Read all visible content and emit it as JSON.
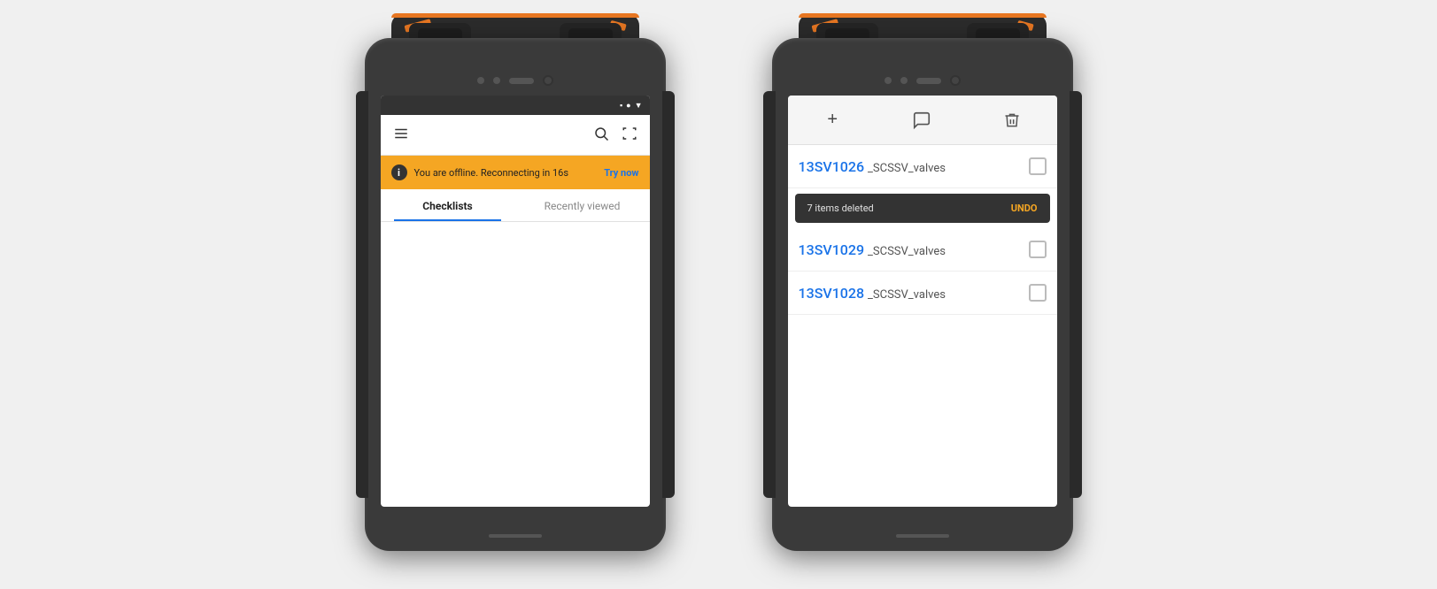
{
  "device1": {
    "status_icons": [
      "▪",
      "●",
      "▼"
    ],
    "appbar": {
      "menu_label": "Menu",
      "search_label": "Search",
      "scan_label": "Scan"
    },
    "offline_banner": {
      "info_icon": "i",
      "message": "You are offline. Reconnecting in 16s",
      "action": "Try now"
    },
    "tabs": [
      {
        "label": "Checklists",
        "active": true
      },
      {
        "label": "Recently viewed",
        "active": false
      }
    ]
  },
  "device2": {
    "toolbar": {
      "add_label": "+",
      "comment_label": "💬",
      "delete_label": "🗑"
    },
    "items": [
      {
        "id": "13SV1026",
        "suffix": "_SCSSV_valves"
      },
      {
        "id": "13SV1029",
        "suffix": "_SCSSV_valves"
      },
      {
        "id": "13SV1028",
        "suffix": "_SCSSV_valves"
      }
    ],
    "snackbar": {
      "message": "7 items deleted",
      "action": "UNDO"
    }
  }
}
